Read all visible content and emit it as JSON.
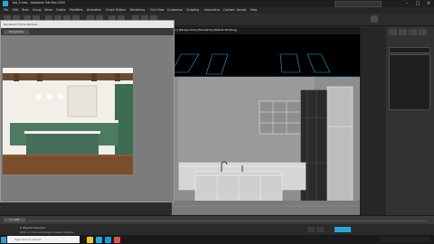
{
  "app": {
    "title": "ket_3.max - Autodesk 3ds Max 2020",
    "search_placeholder": "",
    "win_min": "–",
    "win_max": "□",
    "win_close": "×"
  },
  "menu": [
    "File",
    "Edit",
    "Tools",
    "Group",
    "Views",
    "Create",
    "Modifiers",
    "Animation",
    "Graph Editors",
    "Rendering",
    "Civil View",
    "Customize",
    "Scripting",
    "Interactive",
    "Content",
    "Arnold",
    "Help"
  ],
  "render_frame": {
    "title": "Rendered Frame Window",
    "chip": "Perspective"
  },
  "viewport": {
    "label": "[+] [Perspective] [Standard] [Default Shading]"
  },
  "status": {
    "selection": "0 Objects Selected",
    "hint": "Click or click-and-drag to select objects"
  },
  "timeline": {
    "frame": "0 / 100"
  },
  "taskbar": {
    "search": "Type here to search"
  },
  "colors": {
    "accent": "#2aa7d8",
    "viewport_bg": "#8e8e8e"
  }
}
